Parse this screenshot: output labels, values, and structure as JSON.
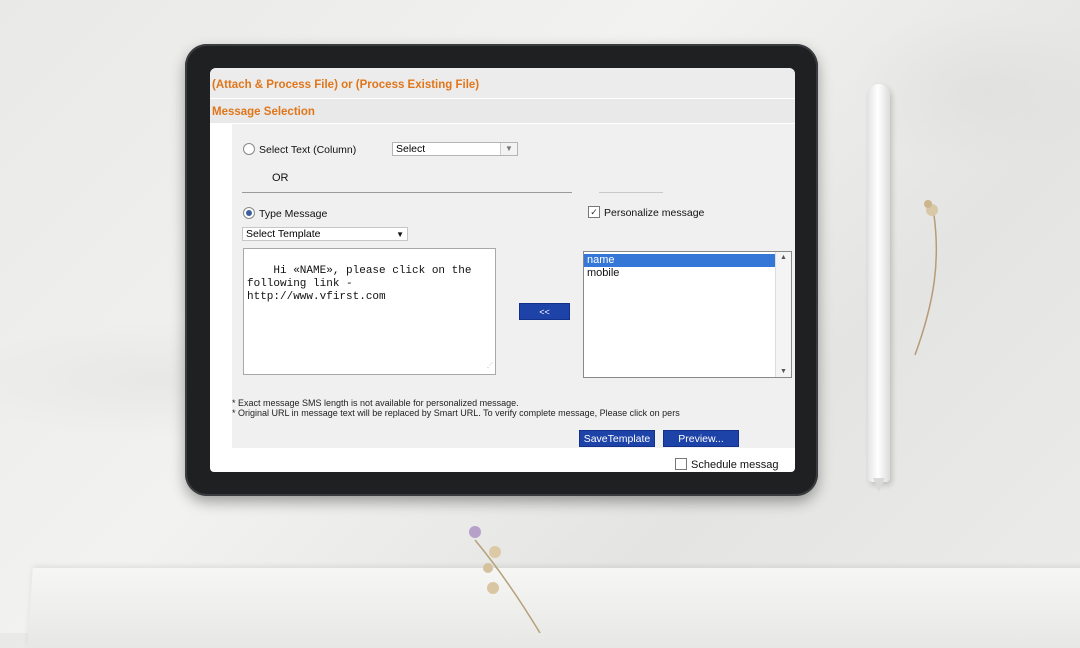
{
  "header": {
    "file_title": "(Attach & Process File) or (Process Existing File)",
    "section_title": "Message Selection"
  },
  "options": {
    "select_text_label": "Select Text (Column)",
    "select_text_value": "Select",
    "or_label": "OR",
    "type_message_label": "Type Message",
    "template_value": "Select Template",
    "personalize_label": "Personalize message",
    "personalize_checked": "✓"
  },
  "message_text": "Hi «NAME», please click on the\nfollowing link -\nhttp://www.vfirst.com",
  "insert_button": "<<",
  "fields": [
    "name",
    "mobile"
  ],
  "notes": [
    "* Exact message SMS length is not available for personalized message.",
    "* Original URL in message text will be replaced by Smart URL. To verify complete message, Please click on pers"
  ],
  "buttons": {
    "save_template": "SaveTemplate",
    "preview": "Preview..."
  },
  "schedule_label": "Schedule messag",
  "colors": {
    "accent_orange": "#e0761a",
    "button_blue": "#1e43a8",
    "selection_blue": "#3477d6"
  }
}
